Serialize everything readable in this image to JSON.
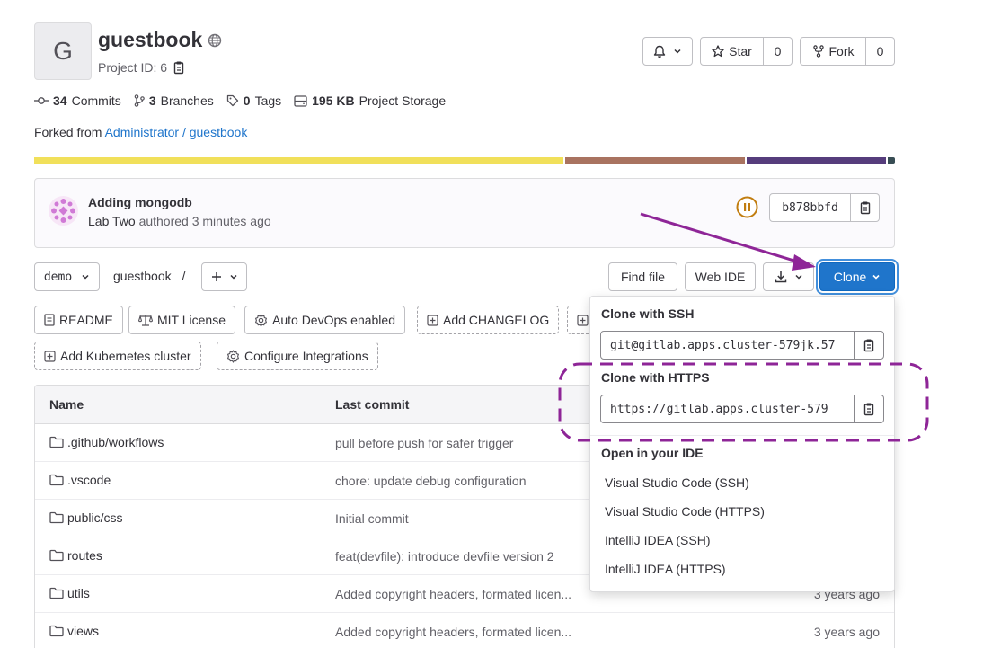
{
  "project": {
    "avatar_letter": "G",
    "name": "guestbook",
    "id_label": "Project ID: 6"
  },
  "header_actions": {
    "star_label": "Star",
    "star_count": "0",
    "fork_label": "Fork",
    "fork_count": "0"
  },
  "stats": {
    "commits_count": "34",
    "commits_label": "Commits",
    "branches_count": "3",
    "branches_label": "Branches",
    "tags_count": "0",
    "tags_label": "Tags",
    "storage_size": "195 KB",
    "storage_label": "Project Storage"
  },
  "fork_info": {
    "prefix": "Forked from",
    "source": "Administrator / guestbook"
  },
  "language_colors": [
    "#f1e05a",
    "#a97360",
    "#563d7c",
    "#384d54"
  ],
  "last_commit": {
    "title": "Adding mongodb",
    "author": "Lab Two",
    "meta": "authored 3 minutes ago",
    "sha": "b878bbfd",
    "pipeline_color": "#c17d10"
  },
  "repo_nav": {
    "ref": "demo",
    "breadcrumb": "guestbook",
    "separator": "/",
    "find_file": "Find file",
    "web_ide": "Web IDE",
    "clone": "Clone"
  },
  "quick_links": {
    "readme": "README",
    "license": "MIT License",
    "autodevops": "Auto DevOps enabled",
    "changelog": "Add CHANGELOG",
    "k8s": "Add Kubernetes cluster",
    "integrations": "Configure Integrations"
  },
  "table": {
    "headers": {
      "name": "Name",
      "last_commit": "Last commit"
    },
    "rows": [
      {
        "name": ".github/workflows",
        "commit": "pull before push for safer trigger",
        "time": ""
      },
      {
        "name": ".vscode",
        "commit": "chore: update debug configuration",
        "time": ""
      },
      {
        "name": "public/css",
        "commit": "Initial commit",
        "time": ""
      },
      {
        "name": "routes",
        "commit": "feat(devfile): introduce devfile version 2",
        "time": ""
      },
      {
        "name": "utils",
        "commit": "Added copyright headers, formated licen...",
        "time": "3 years ago"
      },
      {
        "name": "views",
        "commit": "Added copyright headers, formated licen...",
        "time": "3 years ago"
      }
    ]
  },
  "clone_dropdown": {
    "ssh_label": "Clone with SSH",
    "ssh_url": "git@gitlab.apps.cluster-579jk.57",
    "https_label": "Clone with HTTPS",
    "https_url": "https://gitlab.apps.cluster-579",
    "ide_label": "Open in your IDE",
    "ide_items": [
      "Visual Studio Code (SSH)",
      "Visual Studio Code (HTTPS)",
      "IntelliJ IDEA (SSH)",
      "IntelliJ IDEA (HTTPS)"
    ]
  },
  "annotation_color": "#8e2597"
}
